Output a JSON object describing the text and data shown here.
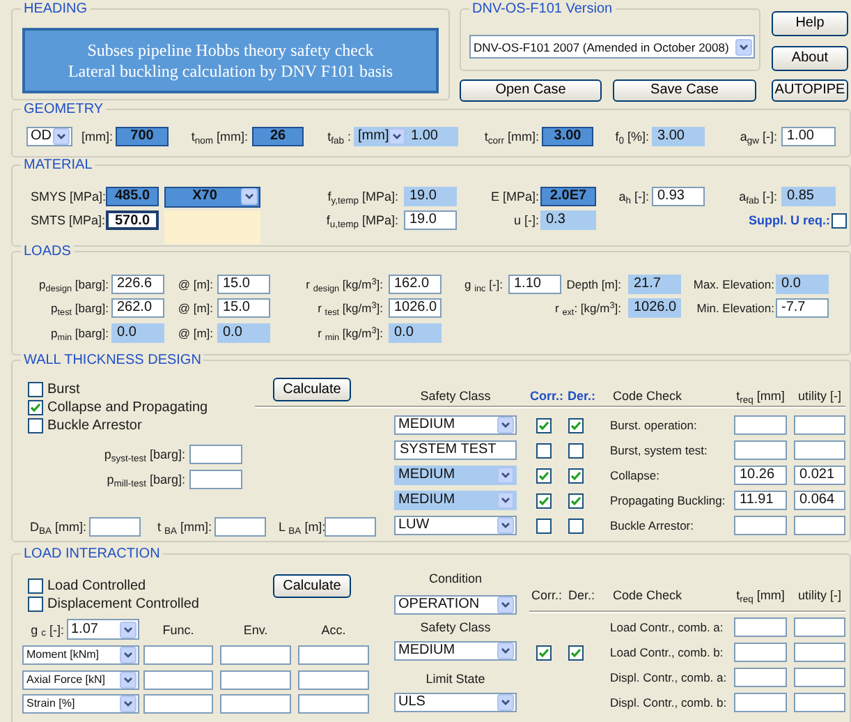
{
  "heading": {
    "title": "HEADING",
    "lines": [
      "Subses pipeline Hobbs theory safety check",
      "Lateral buckling calculation by DNV F101 basis"
    ]
  },
  "version": {
    "title": "DNV-OS-F101 Version",
    "value": "DNV-OS-F101 2007 (Amended in October 2008)"
  },
  "buttons": [
    "Help",
    "About",
    "Open Case",
    "Save Case",
    "AUTOPIPE"
  ],
  "geometry": {
    "title": "GEOMETRY",
    "diameter": "OD",
    "items": [
      {
        "label": "[mm]:",
        "value": "700",
        "highlighted": true,
        "readonly": false
      },
      {
        "label": "t$_{nom}$ [mm]:",
        "value": "26",
        "highlighted": true,
        "readonly": false
      },
      {
        "label": "t$_{fab}$ :",
        "unit": "[mm]",
        "value": "1.00",
        "highlighted": false,
        "readonly": true
      },
      {
        "label": "t$_{corr}$ [mm]:",
        "value": "3.00",
        "highlighted": true,
        "readonly": false
      },
      {
        "label": "f$_{0}$ [%]:",
        "value": "3.00",
        "highlighted": false,
        "readonly": true
      },
      {
        "label": "a$_{gw}$ [-]:",
        "value": "1.00",
        "highlighted": false,
        "readonly": false
      }
    ]
  },
  "material": {
    "title": "MATERIAL",
    "grade": {
      "value": "X70",
      "highlighted": true
    },
    "rows": [
      [
        {
          "label": "SMYS [MPa]:",
          "value": "485.0",
          "highlighted": true,
          "readonly": false
        },
        {
          "label": "f$_{y,temp}$ [MPa]:",
          "value": "19.0",
          "highlighted": false,
          "readonly": true
        },
        {
          "label": "E [MPa]:",
          "value": "2.0E7",
          "highlighted": true,
          "readonly": false
        },
        {
          "label": "a$_{h}$ [-]:",
          "value": "0.93",
          "highlighted": false,
          "readonly": false
        },
        {
          "label": "a$_{fab}$ [-]:",
          "value": "0.85",
          "highlighted": false,
          "readonly": true
        }
      ],
      [
        {
          "label": "SMTS [MPa]:",
          "value": "570.0",
          "highlighted": false,
          "readonly": false,
          "focused": true
        },
        {
          "label": "f$_{u,temp}$ [MPa]:",
          "value": "19.0",
          "highlighted": false,
          "readonly": false
        },
        {
          "label": "u [-]:",
          "value": "0.3",
          "highlighted": false,
          "readonly": true
        }
      ]
    ],
    "suppl": {
      "label": "Suppl. U req.:",
      "checked": false
    }
  },
  "loads": {
    "title": "LOADS",
    "rows": [
      [
        {
          "label": "p$_{design}$ [barg]:",
          "value": "226.6",
          "readonly": false
        },
        {
          "label": "@ [m]:",
          "value": "15.0",
          "readonly": false
        },
        {
          "label": "r $_{design}$ [kg/m$^{3}$]:",
          "value": "162.0",
          "readonly": false
        },
        {
          "label": "g $_{inc}$ [-]:",
          "value": "1.10",
          "readonly": false
        },
        {
          "label": "Depth [m]:",
          "value": "21.7",
          "readonly": true
        },
        {
          "label": "Max. Elevation:",
          "value": "0.0",
          "readonly": true
        }
      ],
      [
        {
          "label": "p$_{test}$ [barg]:",
          "value": "262.0",
          "readonly": false
        },
        {
          "label": "@ [m]:",
          "value": "15.0",
          "readonly": false
        },
        {
          "label": "r $_{test}$ [kg/m$^{3}$]:",
          "value": "1026.0",
          "readonly": false
        },
        null,
        {
          "label": "r $_{ext}$: [kg/m$^{3}$]:",
          "value": "1026.0",
          "readonly": true
        },
        {
          "label": "Min. Elevation:",
          "value": "-7.7",
          "readonly": false
        }
      ],
      [
        {
          "label": "p$_{min}$ [barg]:",
          "value": "0.0",
          "readonly": true
        },
        {
          "label": "@ [m]:",
          "value": "0.0",
          "readonly": true
        },
        {
          "label": "r $_{min}$ [kg/m$^{3}$]:",
          "value": "0.0",
          "readonly": true
        }
      ]
    ]
  },
  "wall": {
    "title": "WALL THICKNESS DESIGN",
    "options": [
      {
        "label": "Burst",
        "checked": false
      },
      {
        "label": "Collapse and Propagating",
        "checked": true
      },
      {
        "label": "Buckle Arrestor",
        "checked": false
      }
    ],
    "calculate": "Calculate",
    "tests": [
      {
        "label": "p$_{syst-test}$ [barg]:"
      },
      {
        "label": "p$_{mill-test}$ [barg]:"
      }
    ],
    "arrestor": [
      {
        "label": "D$_{BA}$ [mm]:"
      },
      {
        "label": "t $_{BA}$ [mm]:"
      },
      {
        "label": "L $_{BA}$ [m]:"
      }
    ],
    "headers": [
      "Safety Class",
      "Corr.:",
      "Der.:",
      "Code Check",
      "t$_{req}$ [mm]",
      "utility [-]"
    ],
    "rows": [
      {
        "kind": "dropdown",
        "safety_class": "MEDIUM",
        "readonly": false,
        "corr": true,
        "der": true,
        "check": "Burst. operation:"
      },
      {
        "kind": "field",
        "safety_class": "SYSTEM TEST",
        "readonly": false,
        "corr": false,
        "der": false,
        "check": "Burst, system test:"
      },
      {
        "kind": "dropdown",
        "safety_class": "MEDIUM",
        "readonly": true,
        "corr": true,
        "der": true,
        "check": "Collapse:",
        "t_req": "10.26",
        "utility": "0.021"
      },
      {
        "kind": "dropdown",
        "safety_class": "MEDIUM",
        "readonly": true,
        "corr": true,
        "der": true,
        "check": "Propagating Buckling:",
        "t_req": "11.91",
        "utility": "0.064"
      },
      {
        "kind": "dropdown",
        "safety_class": "LUW",
        "readonly": false,
        "corr": false,
        "der": false,
        "check": "Buckle Arrestor:"
      }
    ]
  },
  "interaction": {
    "title": "LOAD INTERACTION",
    "options": [
      {
        "label": "Load Controlled",
        "checked": false
      },
      {
        "label": "Displacement Controlled",
        "checked": false
      }
    ],
    "calculate": "Calculate",
    "gamma": {
      "label": "g $_{c}$ [-]:",
      "value": "1.07"
    },
    "columns": [
      "Func.",
      "Env.",
      "Acc."
    ],
    "loads": [
      "Moment [kNm]",
      "Axial Force [kN]",
      "Strain [%]"
    ],
    "settings": [
      {
        "label": "Condition",
        "value": "OPERATION"
      },
      {
        "label": "Safety Class",
        "value": "MEDIUM"
      },
      {
        "label": "Limit State",
        "value": "ULS"
      }
    ],
    "headers": [
      "Corr.:",
      "Der.:",
      "Code Check",
      "t$_{req}$ [mm]",
      "utility [-]"
    ],
    "rows": [
      {
        "check": "Load Contr., comb. a:"
      },
      {
        "check": "Load Contr., comb. b:",
        "corr": true,
        "der": true
      },
      {
        "check": "Displ. Contr., comb. a:"
      },
      {
        "check": "Displ. Contr., comb. b:"
      }
    ]
  }
}
